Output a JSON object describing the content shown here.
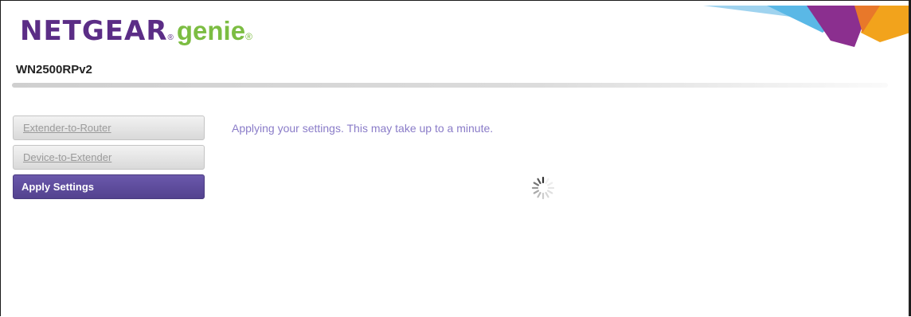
{
  "header": {
    "brand": "NETGEAR",
    "brand_reg": "®",
    "product": "genie",
    "product_mark": "®",
    "model": "WN2500RPv2"
  },
  "sidebar": {
    "items": [
      {
        "label": "Extender-to-Router",
        "state": "inactive"
      },
      {
        "label": "Device-to-Extender",
        "state": "inactive"
      },
      {
        "label": "Apply Settings",
        "state": "active"
      }
    ]
  },
  "main": {
    "message": "Applying your settings. This may take up to a minute.",
    "spinner_icon": "loading-spinner-icon"
  },
  "colors": {
    "brand_purple": "#5b2d86",
    "genie_green": "#7cbd42",
    "active_nav": "#5e4d9e",
    "message_text": "#8a7cc8"
  }
}
